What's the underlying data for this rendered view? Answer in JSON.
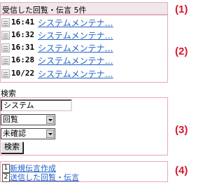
{
  "header": {
    "title": "受信した回覧・伝言 5件"
  },
  "messages": [
    {
      "time": "16:41",
      "subject": "システムメンテナ…"
    },
    {
      "time": "16:32",
      "subject": "システムメンテナ…"
    },
    {
      "time": "16:31",
      "subject": "システムメンテナ…"
    },
    {
      "time": "16:28",
      "subject": "システムメンテナ…"
    },
    {
      "time": "10/22",
      "subject": "システムメンテナ…"
    }
  ],
  "search": {
    "label": "検索",
    "keyword": "システム",
    "type_selected": "回覧",
    "status_selected": "未確認",
    "button_label": "検索"
  },
  "footer": {
    "links": [
      {
        "num": "1",
        "label": "新規伝言作成"
      },
      {
        "num": "2",
        "label": "送信した回覧・伝言"
      }
    ]
  },
  "callouts": [
    "(1)",
    "(2)",
    "(3)",
    "(4)"
  ],
  "colors": {
    "link": "#2060c8",
    "callout": "#d61a2a",
    "box_border": "#e6a9b2"
  }
}
